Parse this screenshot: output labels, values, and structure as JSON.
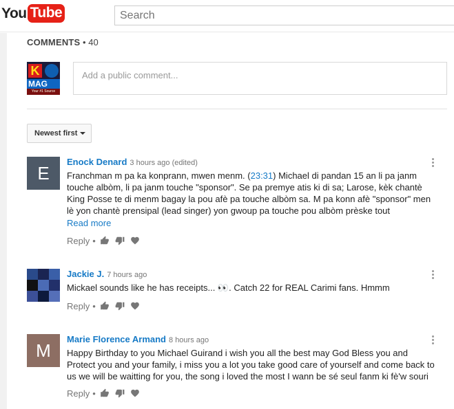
{
  "header": {
    "logo_you": "You",
    "logo_tube": "Tube",
    "search_placeholder": "Search"
  },
  "comments": {
    "title": "COMMENTS",
    "count": "40",
    "add_placeholder": "Add a public comment...",
    "sort_label": "Newest first",
    "current_user_avatar_text": {
      "top": "K",
      "mag": "MAG",
      "tag": "Your #1 Source"
    },
    "items": [
      {
        "author": "Enock Denard",
        "time": "3 hours ago (edited)",
        "avatar_letter": "E",
        "avatar_color": "#4d5967",
        "text_before": "Franchman m pa ka konprann, mwen menm. (",
        "timestamp_link": "23:31",
        "text_after": ") Michael di pandan 15 an li pa janm touche albòm, li pa janm touche \"sponsor\". Se pa premye atis ki di sa; Larose, kèk chantè King Posse te di menm bagay la pou afè pa touche albòm sa. M pa konn afè \"sponsor\" men lè yon chantè prensipal (lead singer) yon gwoup pa touche pou albòm prèske tout",
        "read_more": "Read more",
        "reply": "Reply"
      },
      {
        "author": "Jackie J.",
        "time": "7 hours ago",
        "text": "Mickael sounds like he has receipts... 👀. Catch 22 for REAL Carimi fans. Hmmm",
        "reply": "Reply"
      },
      {
        "author": "Marie Florence Armand",
        "time": "8 hours ago",
        "avatar_letter": "M",
        "avatar_color": "#8d6e63",
        "text": "Happy Birthday to you Michael Guirand i wish you all the best may God Bless you and Protect you and your family, i miss you a lot you take good care of yourself and come back to us we will be waitting for you, the song i loved the most I wann be sé seul fanm ki fè'w souri",
        "reply": "Reply"
      }
    ]
  },
  "colors": {
    "brand_red": "#e62117",
    "link_blue": "#167ac6"
  }
}
